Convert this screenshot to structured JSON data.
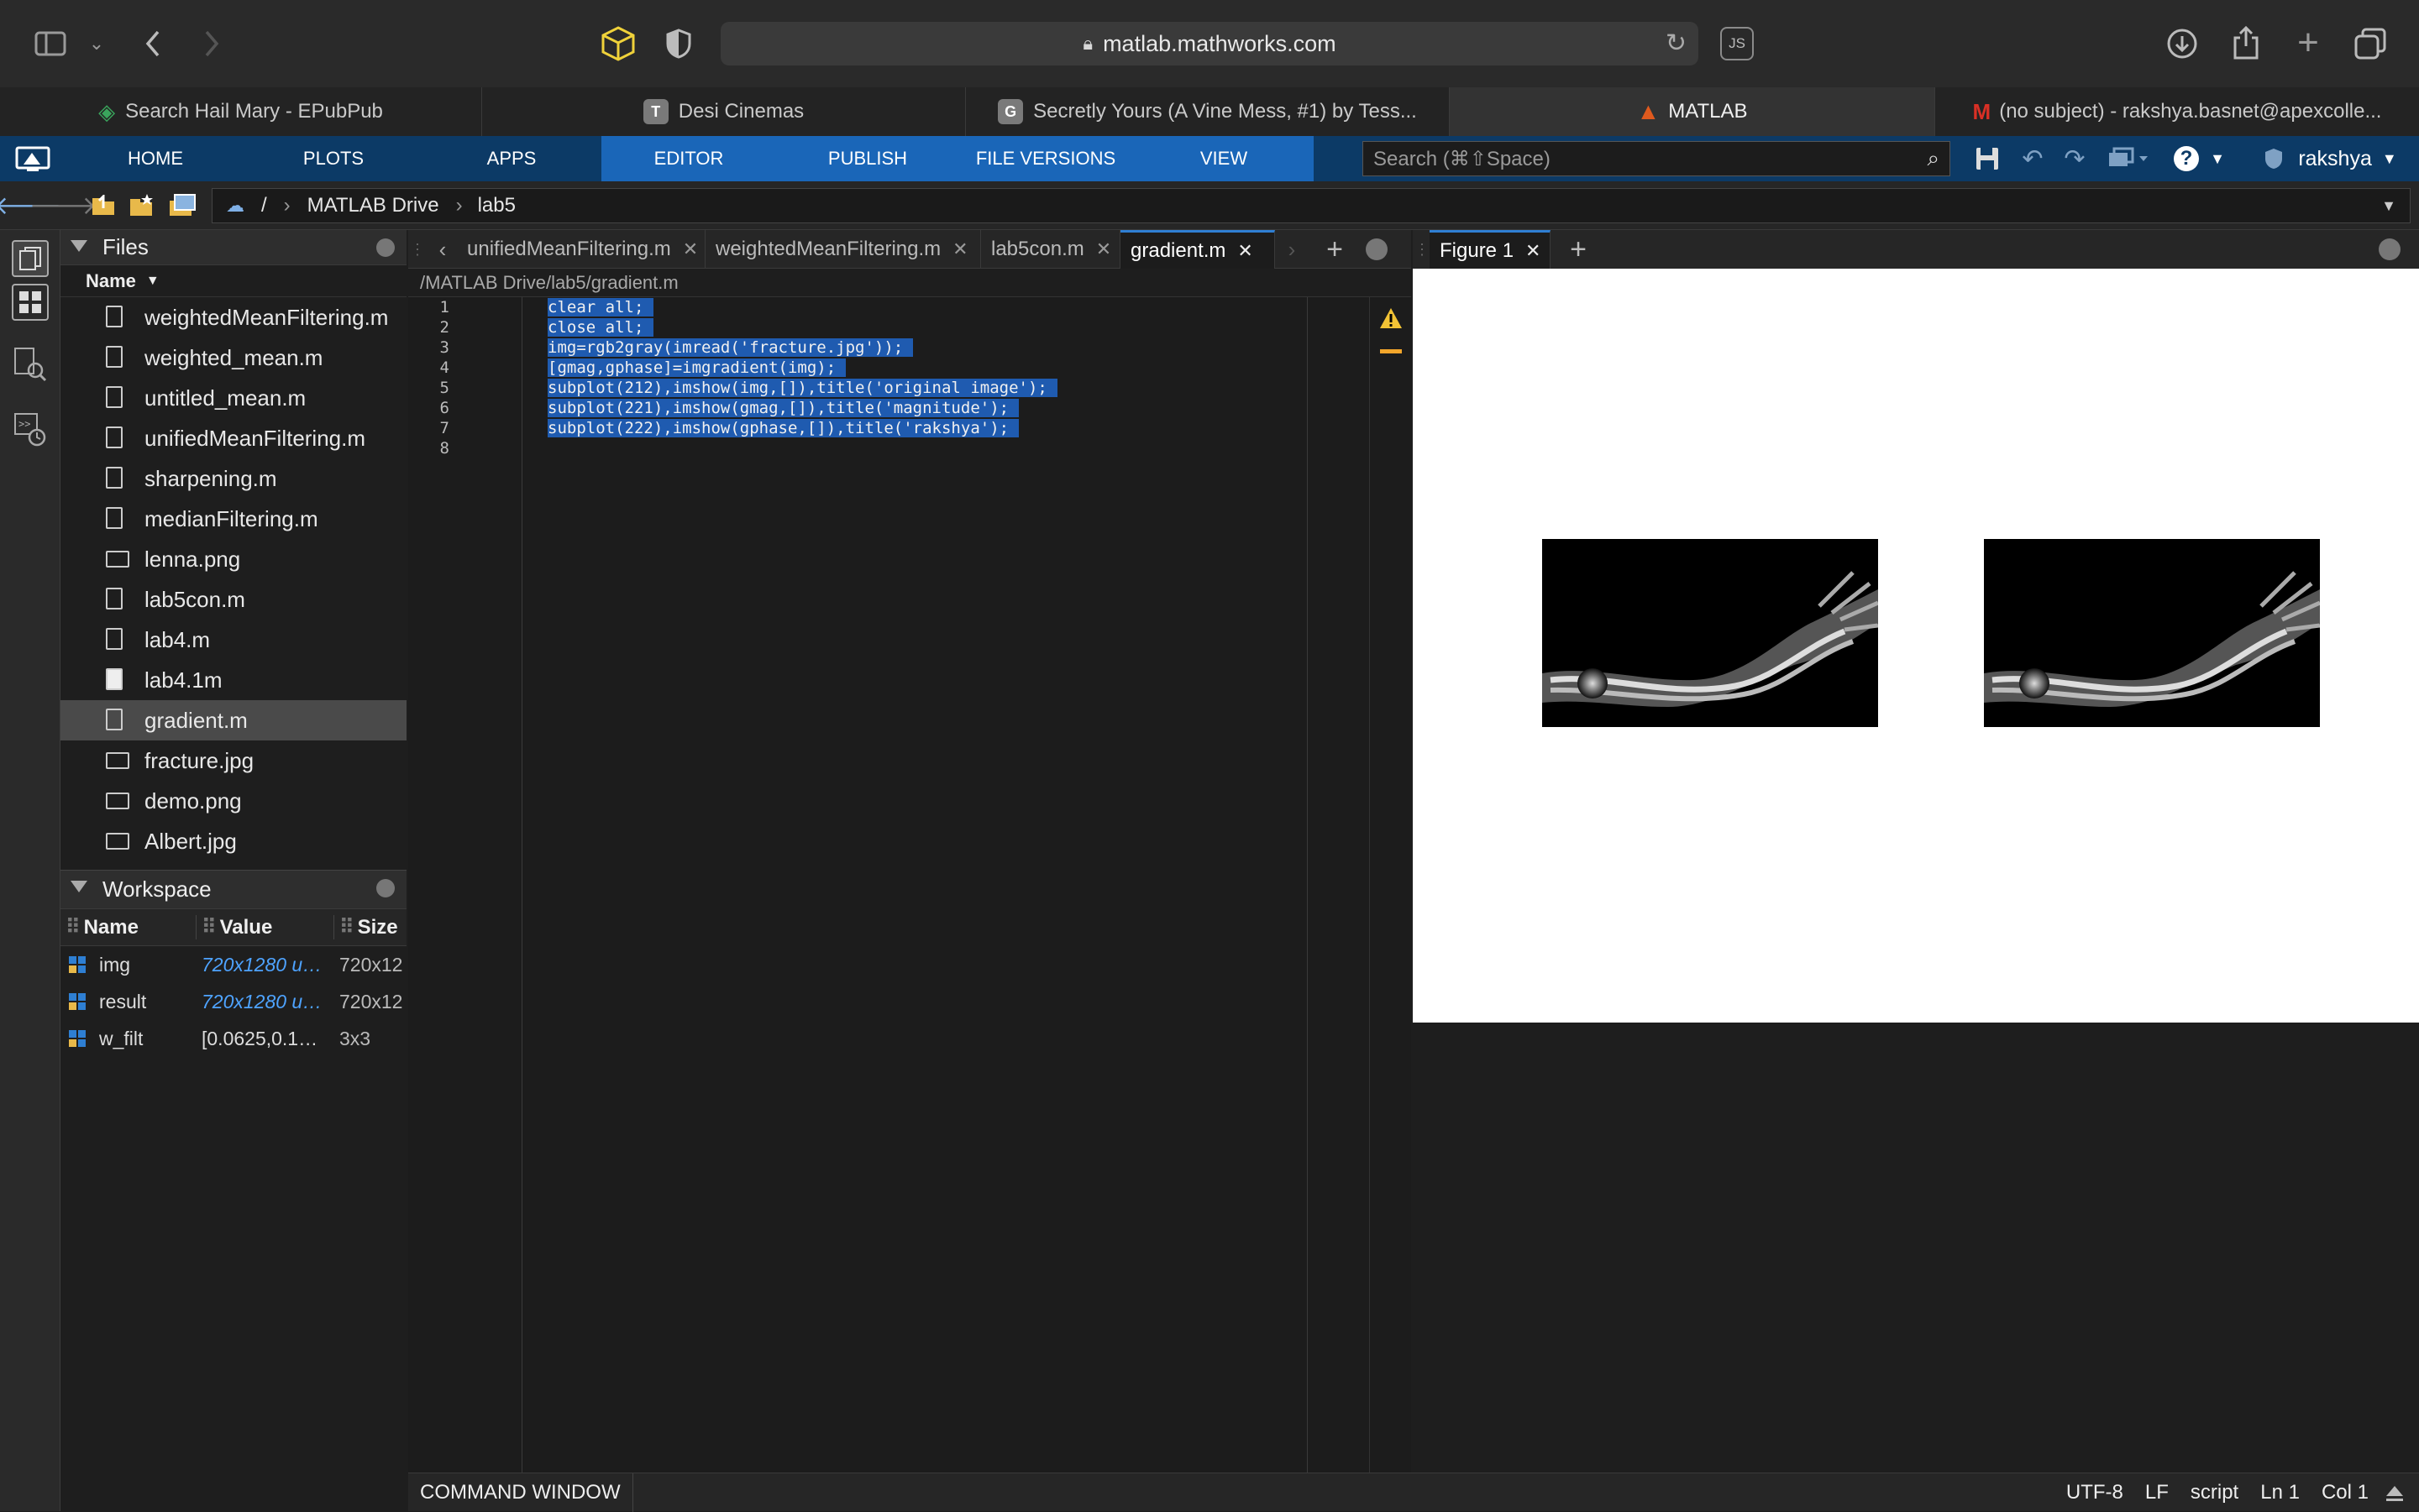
{
  "browser": {
    "url": "matlab.mathworks.com",
    "js_label": "JS",
    "tabs": [
      {
        "label": "Search Hail Mary - EPubPub",
        "icon": "book-stack-icon",
        "color": "#3aa55c"
      },
      {
        "label": "Desi Cinemas",
        "icon_letter": "T",
        "color": "#7a7a7a"
      },
      {
        "label": "Secretly Yours (A Vine Mess, #1) by Tess...",
        "icon_letter": "G",
        "color": "#7a7a7a"
      },
      {
        "label": "MATLAB",
        "icon": "matlab-icon",
        "color": "#e05a1e"
      },
      {
        "label": "(no subject) - rakshya.basnet@apexcolle...",
        "icon": "gmail-icon",
        "color": "#d93025"
      }
    ]
  },
  "ribbon": {
    "tabs": [
      "HOME",
      "PLOTS",
      "APPS",
      "EDITOR",
      "PUBLISH",
      "FILE VERSIONS",
      "VIEW"
    ],
    "search_placeholder": "Search (⌘⇧Space)",
    "user": "rakshya",
    "help": "?"
  },
  "path": {
    "root": "/",
    "drive": "MATLAB Drive",
    "folder": "lab5"
  },
  "files": {
    "title": "Files",
    "column": "Name",
    "items": [
      {
        "name": "weightedMeanFiltering.m",
        "type": "m"
      },
      {
        "name": "weighted_mean.m",
        "type": "m"
      },
      {
        "name": "untitled_mean.m",
        "type": "m"
      },
      {
        "name": "unifiedMeanFiltering.m",
        "type": "m"
      },
      {
        "name": "sharpening.m",
        "type": "m"
      },
      {
        "name": "medianFiltering.m",
        "type": "m"
      },
      {
        "name": "lenna.png",
        "type": "img"
      },
      {
        "name": "lab5con.m",
        "type": "m"
      },
      {
        "name": "lab4.m",
        "type": "m"
      },
      {
        "name": "lab4.1m",
        "type": "plain"
      },
      {
        "name": "gradient.m",
        "type": "m",
        "selected": true
      },
      {
        "name": "fracture.jpg",
        "type": "img"
      },
      {
        "name": "demo.png",
        "type": "img"
      },
      {
        "name": "Albert.jpg",
        "type": "img"
      }
    ]
  },
  "workspace": {
    "title": "Workspace",
    "columns": [
      "Name",
      "Value",
      "Size"
    ],
    "rows": [
      {
        "name": "img",
        "value": "720x1280 u…",
        "size": "720x12",
        "link": true
      },
      {
        "name": "result",
        "value": "720x1280 u…",
        "size": "720x12",
        "link": true
      },
      {
        "name": "w_filt",
        "value": "[0.0625,0.1…",
        "size": "3x3",
        "link": false
      }
    ]
  },
  "editor": {
    "tabs": [
      "unifiedMeanFiltering.m",
      "weightedMeanFiltering.m",
      "lab5con.m",
      "gradient.m"
    ],
    "active_tab": "gradient.m",
    "file_path": "/MATLAB Drive/lab5/gradient.m",
    "lines": [
      "clear all;",
      "close all;",
      "img=rgb2gray(imread('fracture.jpg'));",
      "[gmag,gphase]=imgradient(img);",
      "subplot(212),imshow(img,[]),title('original image');",
      "subplot(221),imshow(gmag,[]),title('magnitude');",
      "subplot(222),imshow(gphase,[]),title('rakshya');",
      ""
    ],
    "line_numbers": [
      "1",
      "2",
      "3",
      "4",
      "5",
      "6",
      "7",
      "8"
    ]
  },
  "figure": {
    "tab": "Figure 1"
  },
  "status": {
    "command_window": "COMMAND WINDOW",
    "encoding": "UTF-8",
    "line_ending": "LF",
    "mode": "script",
    "ln": "Ln",
    "ln_val": "1",
    "col": "Col",
    "col_val": "1"
  },
  "colors": {
    "ribbon": "#0c3a66",
    "ribbon_active": "#1a66b8",
    "selection": "#1f5bb0"
  }
}
